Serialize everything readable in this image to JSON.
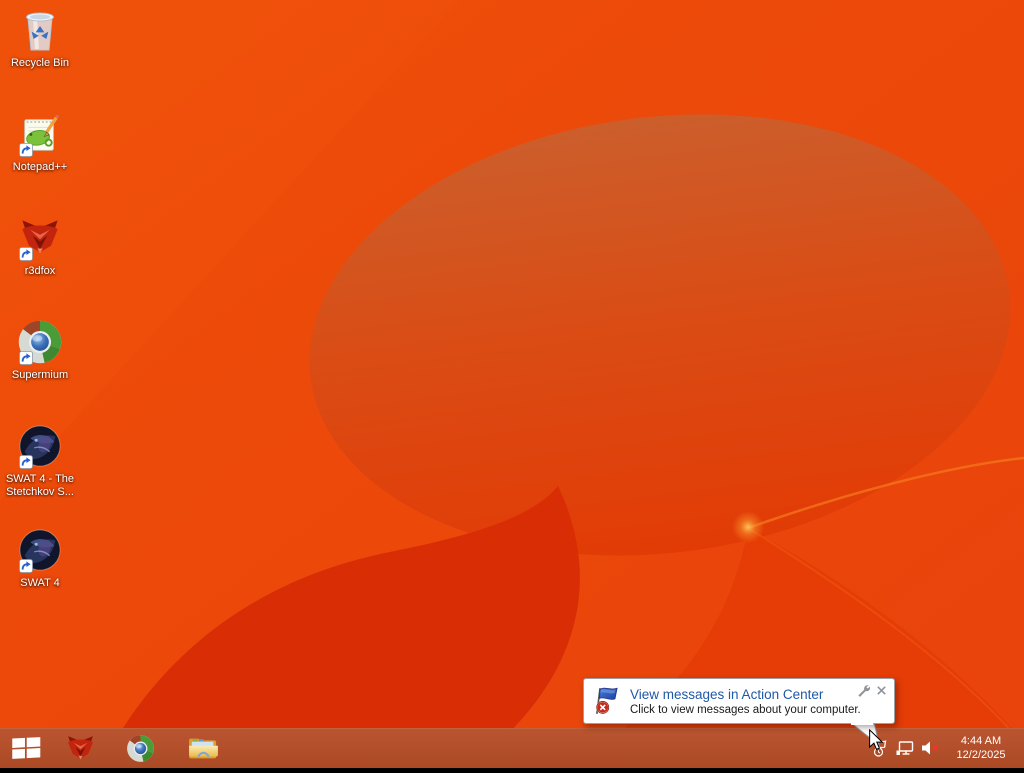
{
  "colors": {
    "wallpaper_base": "#ea4708",
    "wallpaper_muted_blob": "#c9602f",
    "wallpaper_dark_petal": "#d92d06",
    "wallpaper_glint": "#ffc95e",
    "taskbar": "#b14e2a",
    "balloon_title_blue": "#2058a8",
    "balloon_border": "#9aa0a5",
    "volume_mute_red": "#e8392b"
  },
  "desktop": {
    "icons": [
      {
        "label": "Recycle Bin",
        "icon": "recycle-bin-icon",
        "shortcut": false
      },
      {
        "label": "Notepad++",
        "icon": "notepadpp-icon",
        "shortcut": true
      },
      {
        "label": "r3dfox",
        "icon": "r3dfox-icon",
        "shortcut": true
      },
      {
        "label": "Supermium",
        "icon": "supermium-icon",
        "shortcut": true
      },
      {
        "label": "SWAT 4 - The Stetchkov S...",
        "icon": "swat4-icon",
        "shortcut": true
      },
      {
        "label": "SWAT 4",
        "icon": "swat4-icon",
        "shortcut": true
      }
    ]
  },
  "notification": {
    "title": "View messages in Action Center",
    "body": "Click to view messages about your computer.",
    "icon": "action-center-flag-error-icon",
    "tool_icons": [
      "settings-wrench-icon",
      "close-icon"
    ]
  },
  "taskbar": {
    "buttons": [
      {
        "name": "start",
        "icon": "windows-start-icon"
      },
      {
        "name": "r3dfox",
        "icon": "r3dfox-icon"
      },
      {
        "name": "supermium",
        "icon": "supermium-icon"
      },
      {
        "name": "file-explorer",
        "icon": "folder-icon"
      }
    ],
    "tray": [
      {
        "name": "action-center",
        "icon": "flag-clock-icon"
      },
      {
        "name": "network",
        "icon": "network-icon"
      },
      {
        "name": "volume",
        "icon": "volume-muted-icon"
      }
    ],
    "clock": {
      "time": "4:44 AM",
      "date": "12/2/2025"
    }
  }
}
